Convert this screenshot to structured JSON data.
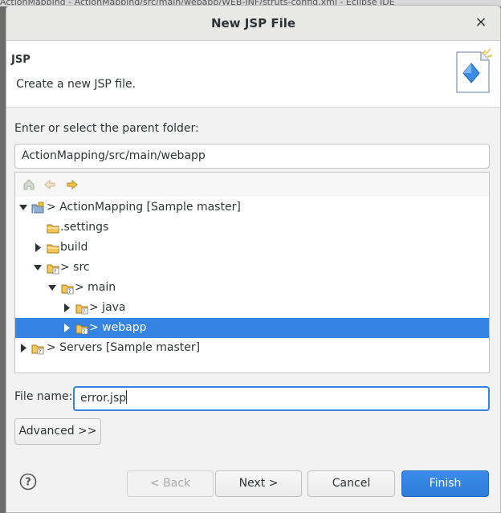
{
  "background": {
    "ide_title_fragment": "ActionMapping - ActionMapping/src/main/webapp/WEB-INF/struts-config.xml - Eclipse IDE"
  },
  "dialog": {
    "title": "New JSP File",
    "close_glyph": "×"
  },
  "header": {
    "title": "JSP",
    "description": "Create a new JSP file.",
    "icon": "new-jsp-wizard-icon"
  },
  "parent_folder": {
    "label": "Enter or select the parent folder:",
    "value": "ActionMapping/src/main/webapp"
  },
  "tree_toolbar": {
    "icons": [
      "home-icon",
      "back-arrow-icon",
      "forward-arrow-icon"
    ]
  },
  "tree": {
    "items": [
      {
        "label": "> ActionMapping [Sample master]",
        "expanded": true,
        "selected": false
      },
      {
        "label": ".settings",
        "expanded": null,
        "selected": false
      },
      {
        "label": "build",
        "expanded": false,
        "selected": false
      },
      {
        "label": "> src",
        "expanded": true,
        "selected": false
      },
      {
        "label": "> main",
        "expanded": true,
        "selected": false
      },
      {
        "label": "> java",
        "expanded": false,
        "selected": false
      },
      {
        "label": "> webapp",
        "expanded": false,
        "selected": true
      },
      {
        "label": "> Servers [Sample master]",
        "expanded": false,
        "selected": false
      }
    ]
  },
  "file_name": {
    "label": "File name:",
    "value": "error.jsp"
  },
  "buttons": {
    "advanced": "Advanced >>",
    "back": "< Back",
    "next": "Next >",
    "cancel": "Cancel",
    "finish": "Finish"
  },
  "colors": {
    "accent": "#3584e4",
    "folder": "#e8b84a",
    "arrow": "#e0a020"
  }
}
